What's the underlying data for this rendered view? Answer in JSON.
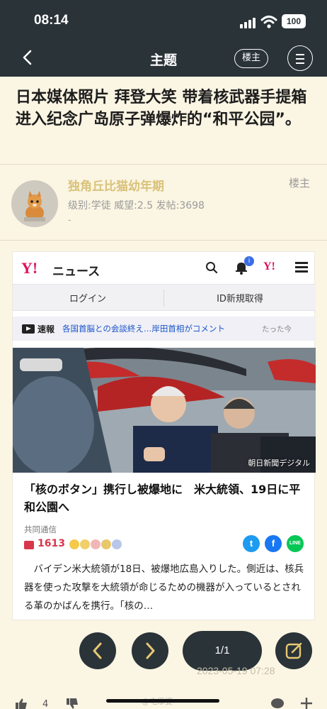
{
  "status_bar": {
    "time": "08:14",
    "battery": "100"
  },
  "nav": {
    "title": "主题",
    "op_button": "楼主"
  },
  "post": {
    "title": "日本媒体照片 拜登大笑 带着核武器手提箱进入纪念广岛原子弹爆炸的“和平公园”。",
    "author": "独角丘比猫幼年期",
    "op_tag": "楼主",
    "meta": "级别:学徒  威望:2.5  发帖:3698",
    "dash": "-"
  },
  "embedded": {
    "logo": "Y!",
    "site_name": "ニュース",
    "notification_badge": "i",
    "header_logo_small": "Y!",
    "login": "ログイン",
    "register": "ID新規取得",
    "breaking_label": "速報",
    "breaking_text": "各国首脳との会談終え…岸田首相がコメント",
    "breaking_time": "たった今",
    "photo_credit": "朝日新聞デジタル",
    "headline": "「核のボタン」携行し被爆地に　米大統領、19日に平和公園へ",
    "source": "共同通信",
    "comment_count": "1613",
    "share_twitter": "t",
    "share_facebook": "f",
    "share_line": "LINE",
    "body": "　バイデン米大統領が18日、被爆地広島入りした。側近は、核兵器を使った攻撃を大統領が命じるための機器が入っているとされる革のかばんを携行。「核の…"
  },
  "controls": {
    "pager": "1/1",
    "timestamp": "2023-05-19 07:28",
    "like_count": "4",
    "watermark": "@电摩婆"
  },
  "colors": {
    "bar": "#2a3338",
    "background": "#fbf5e3",
    "author": "#d9c27a",
    "yahoo_red": "#e0115f",
    "link_blue": "#1a55c8"
  }
}
